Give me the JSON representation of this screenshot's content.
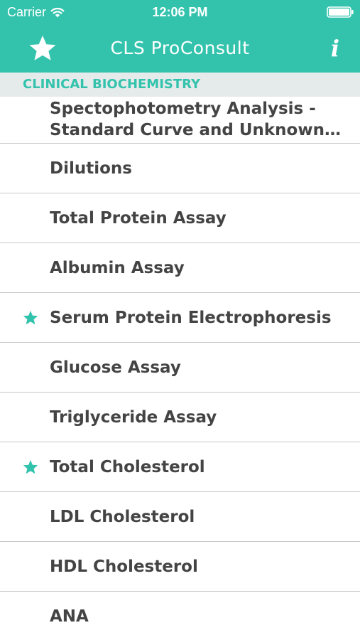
{
  "status_bar": {
    "carrier": "Carrier",
    "time": "12:06 PM",
    "wifi_icon": "wifi-icon",
    "battery_icon": "battery-icon"
  },
  "nav": {
    "title": "CLS ProConsult",
    "favorites_icon": "star-icon",
    "info_label": "i"
  },
  "section": {
    "title": "CLINICAL BIOCHEMISTRY"
  },
  "items": [
    {
      "label": "Spectophotometry Analysis - Standard Curve and Unknown S…",
      "starred": false
    },
    {
      "label": "Dilutions",
      "starred": false
    },
    {
      "label": "Total Protein Assay",
      "starred": false
    },
    {
      "label": "Albumin Assay",
      "starred": false
    },
    {
      "label": "Serum Protein Electrophoresis",
      "starred": true
    },
    {
      "label": "Glucose Assay",
      "starred": false
    },
    {
      "label": "Triglyceride Assay",
      "starred": false
    },
    {
      "label": "Total Cholesterol",
      "starred": true
    },
    {
      "label": "LDL Cholesterol",
      "starred": false
    },
    {
      "label": "HDL Cholesterol",
      "starred": false
    },
    {
      "label": "ANA",
      "starred": false
    }
  ],
  "colors": {
    "accent": "#33c3ad",
    "section_background": "#e5eaea",
    "row_text": "#444444",
    "separator": "#c8c7cc"
  }
}
